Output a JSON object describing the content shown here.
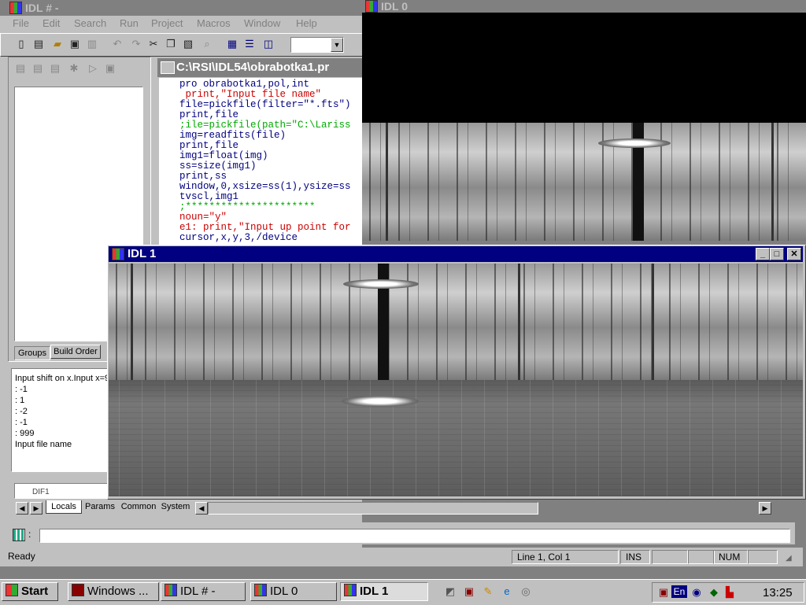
{
  "main_window": {
    "title": "IDL # -",
    "menu": [
      "File",
      "Edit",
      "Search",
      "Run",
      "Project",
      "Macros",
      "Window",
      "Help"
    ],
    "toolbar_icons": [
      "new-file-icon",
      "new-project-icon",
      "open-icon",
      "save-icon",
      "print-icon",
      "undo-icon",
      "redo-icon",
      "cut-icon",
      "copy-icon",
      "paste-icon",
      "find-icon",
      "tile-icon",
      "cascade-icon",
      "columns-icon"
    ],
    "project_tabs": [
      "Groups",
      "Build Order"
    ],
    "editor_title": "C:\\RSI\\IDL54\\obrabotka1.pr",
    "code_lines": [
      {
        "text": "pro obrabotka1,pol,int",
        "color": "#000080"
      },
      {
        "text": " print,\"Input file name\"",
        "color": "#cc0000"
      },
      {
        "text": "file=pickfile(filter=\"*.fts\")",
        "color": "#000080"
      },
      {
        "text": "print,file",
        "color": "#000080"
      },
      {
        "text": ";ile=pickfile(path=\"C:\\Lariss",
        "color": "#00aa00"
      },
      {
        "text": "img=readfits(file)",
        "color": "#000080"
      },
      {
        "text": "print,file",
        "color": "#000080"
      },
      {
        "text": "img1=float(img)",
        "color": "#000080"
      },
      {
        "text": "ss=size(img1)",
        "color": "#000080"
      },
      {
        "text": "print,ss",
        "color": "#000080"
      },
      {
        "text": "window,0,xsize=ss(1),ysize=ss",
        "color": "#000080"
      },
      {
        "text": "tvscl,img1",
        "color": "#000080"
      },
      {
        "text": ";**********************",
        "color": "#00aa00"
      },
      {
        "text": "noun=\"y\"",
        "color": "#cc0000"
      },
      {
        "text": "e1: print,\"Input up point for",
        "color": "#cc0000"
      },
      {
        "text": "cursor,x,y,3,/device",
        "color": "#000080"
      }
    ],
    "output_lines": [
      "Input shift on x.Input x=9",
      ": -1",
      ": 1",
      ": -2",
      ": -1",
      ": 999",
      "Input file name"
    ],
    "variable_tabs": [
      "Locals",
      "Params",
      "Common",
      "System"
    ],
    "variable_partial_text": "DIF1",
    "command_prompt": ":",
    "command_value": "",
    "status": {
      "ready": "Ready",
      "position": "Line 1, Col 1",
      "ins": "INS",
      "num": "NUM"
    }
  },
  "idl0_window": {
    "title": "IDL 0"
  },
  "idl1_window": {
    "title": "IDL 1"
  },
  "taskbar": {
    "start": "Start",
    "tasks": [
      "Windows ...",
      "IDL # -",
      "IDL 0",
      "IDL 1"
    ],
    "language": "En",
    "clock": "13:25"
  }
}
